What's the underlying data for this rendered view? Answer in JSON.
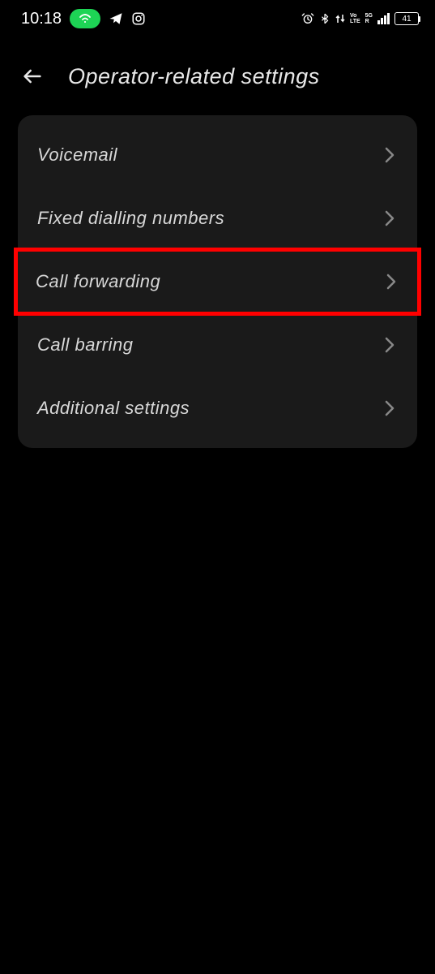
{
  "status_bar": {
    "time": "10:18",
    "battery_level": "41"
  },
  "header": {
    "title": "Operator-related settings"
  },
  "settings": {
    "items": [
      {
        "label": "Voicemail",
        "highlighted": false
      },
      {
        "label": "Fixed dialling numbers",
        "highlighted": false
      },
      {
        "label": "Call forwarding",
        "highlighted": true
      },
      {
        "label": "Call barring",
        "highlighted": false
      },
      {
        "label": "Additional settings",
        "highlighted": false
      }
    ]
  }
}
